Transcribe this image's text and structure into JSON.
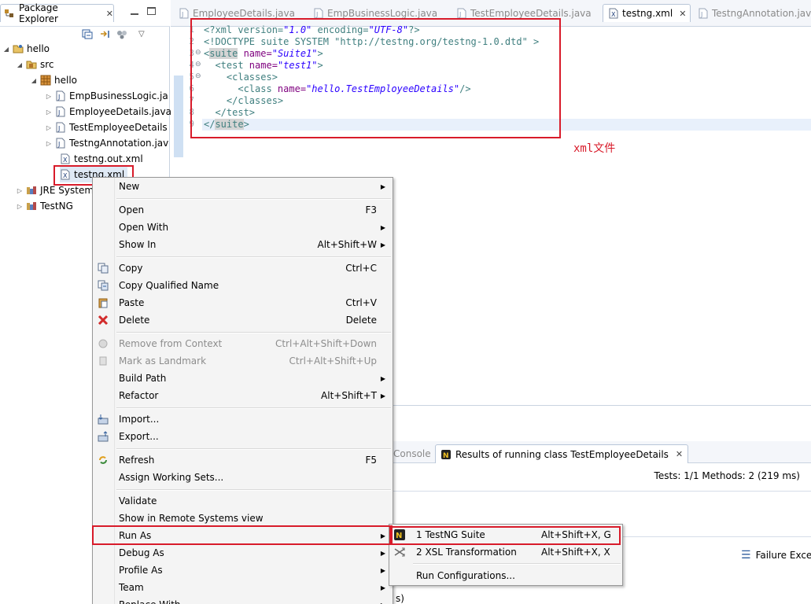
{
  "package_explorer": {
    "tab_label": "Package Explorer",
    "tree": {
      "project": "hello",
      "src": "src",
      "package": "hello",
      "files": [
        "EmpBusinessLogic.ja",
        "EmployeeDetails.java",
        "TestEmployeeDetails",
        "TestngAnnotation.jav",
        "testng.out.xml",
        "testng.xml"
      ],
      "libraries": [
        "JRE System",
        "TestNG"
      ]
    }
  },
  "editor": {
    "tabs": [
      {
        "label": "EmployeeDetails.java",
        "active": false
      },
      {
        "label": "EmpBusinessLogic.java",
        "active": false
      },
      {
        "label": "TestEmployeeDetails.java",
        "active": false
      },
      {
        "label": "testng.xml",
        "active": true
      },
      {
        "label": "TestngAnnotation.java",
        "active": false
      }
    ],
    "line_numbers": [
      "1",
      "2",
      "3",
      "4",
      "5",
      "6",
      "7",
      "8",
      "9"
    ],
    "code": {
      "l1": [
        "<?xml version=",
        "\"1.0\"",
        " encoding=",
        "\"UTF-8\"",
        "?>"
      ],
      "l2": "<!DOCTYPE suite SYSTEM \"http://testng.org/testng-1.0.dtd\" >",
      "l3": [
        "<",
        "suite",
        " name=",
        "\"Suite1\"",
        ">"
      ],
      "l4": [
        "  <test",
        " name=",
        "\"test1\"",
        ">"
      ],
      "l5": "    <classes>",
      "l6": [
        "      <class",
        " name=",
        "\"hello.TestEmployeeDetails\"",
        "/>"
      ],
      "l7": "    </classes>",
      "l8": "  </test>",
      "l9": [
        "</",
        "suite",
        ">"
      ]
    },
    "annotation": "xml文件"
  },
  "bottom_panel": {
    "tabs": [
      {
        "label": "Console",
        "active": false
      },
      {
        "label": "Results of running class TestEmployeeDetails",
        "active": true
      }
    ],
    "stats": "Tests: 1/1  Methods: 2 (219 ms)",
    "failure_label": "Failure Exce",
    "fragment": "s)"
  },
  "context_menu": {
    "items": [
      {
        "label": "New",
        "shortcut": "",
        "submenu": true,
        "icon": "",
        "disabled": false
      },
      {
        "label": "Open",
        "shortcut": "F3",
        "submenu": false,
        "icon": "",
        "disabled": false
      },
      {
        "label": "Open With",
        "shortcut": "",
        "submenu": true,
        "icon": "",
        "disabled": false
      },
      {
        "label": "Show In",
        "shortcut": "Alt+Shift+W",
        "submenu": true,
        "icon": "",
        "disabled": false
      },
      {
        "label": "Copy",
        "shortcut": "Ctrl+C",
        "submenu": false,
        "icon": "copy-icon",
        "disabled": false
      },
      {
        "label": "Copy Qualified Name",
        "shortcut": "",
        "submenu": false,
        "icon": "copy-qualified-name-icon",
        "disabled": false
      },
      {
        "label": "Paste",
        "shortcut": "Ctrl+V",
        "submenu": false,
        "icon": "paste-icon",
        "disabled": false
      },
      {
        "label": "Delete",
        "shortcut": "Delete",
        "submenu": false,
        "icon": "delete-icon",
        "disabled": false
      },
      {
        "label": "Remove from Context",
        "shortcut": "Ctrl+Alt+Shift+Down",
        "submenu": false,
        "icon": "remove-context-icon",
        "disabled": true
      },
      {
        "label": "Mark as Landmark",
        "shortcut": "Ctrl+Alt+Shift+Up",
        "submenu": false,
        "icon": "landmark-icon",
        "disabled": true
      },
      {
        "label": "Build Path",
        "shortcut": "",
        "submenu": true,
        "icon": "",
        "disabled": false
      },
      {
        "label": "Refactor",
        "shortcut": "Alt+Shift+T",
        "submenu": true,
        "icon": "",
        "disabled": false
      },
      {
        "label": "Import...",
        "shortcut": "",
        "submenu": false,
        "icon": "import-icon",
        "disabled": false
      },
      {
        "label": "Export...",
        "shortcut": "",
        "submenu": false,
        "icon": "export-icon",
        "disabled": false
      },
      {
        "label": "Refresh",
        "shortcut": "F5",
        "submenu": false,
        "icon": "refresh-icon",
        "disabled": false
      },
      {
        "label": "Assign Working Sets...",
        "shortcut": "",
        "submenu": false,
        "icon": "",
        "disabled": false
      },
      {
        "label": "Validate",
        "shortcut": "",
        "submenu": false,
        "icon": "",
        "disabled": false
      },
      {
        "label": "Show in Remote Systems view",
        "shortcut": "",
        "submenu": false,
        "icon": "",
        "disabled": false
      },
      {
        "label": "Run As",
        "shortcut": "",
        "submenu": true,
        "icon": "",
        "disabled": false
      },
      {
        "label": "Debug As",
        "shortcut": "",
        "submenu": true,
        "icon": "",
        "disabled": false
      },
      {
        "label": "Profile As",
        "shortcut": "",
        "submenu": true,
        "icon": "",
        "disabled": false
      },
      {
        "label": "Team",
        "shortcut": "",
        "submenu": true,
        "icon": "",
        "disabled": false
      },
      {
        "label": "Replace With",
        "shortcut": "",
        "submenu": true,
        "icon": "",
        "disabled": false
      }
    ]
  },
  "run_as_submenu": {
    "items": [
      {
        "label": "1 TestNG Suite",
        "shortcut": "Alt+Shift+X, G",
        "icon": "testng-icon"
      },
      {
        "label": "2 XSL Transformation",
        "shortcut": "Alt+Shift+X, X",
        "icon": "xsl-transform-icon"
      },
      {
        "label": "Run Configurations...",
        "shortcut": "",
        "icon": ""
      }
    ]
  },
  "colors": {
    "highlight_red": "#d81b2a",
    "menu_background": "#f4f4f4",
    "xml_tag": "#3f7f7f",
    "xml_attr": "#7f007f",
    "xml_value": "#2a00ff"
  }
}
